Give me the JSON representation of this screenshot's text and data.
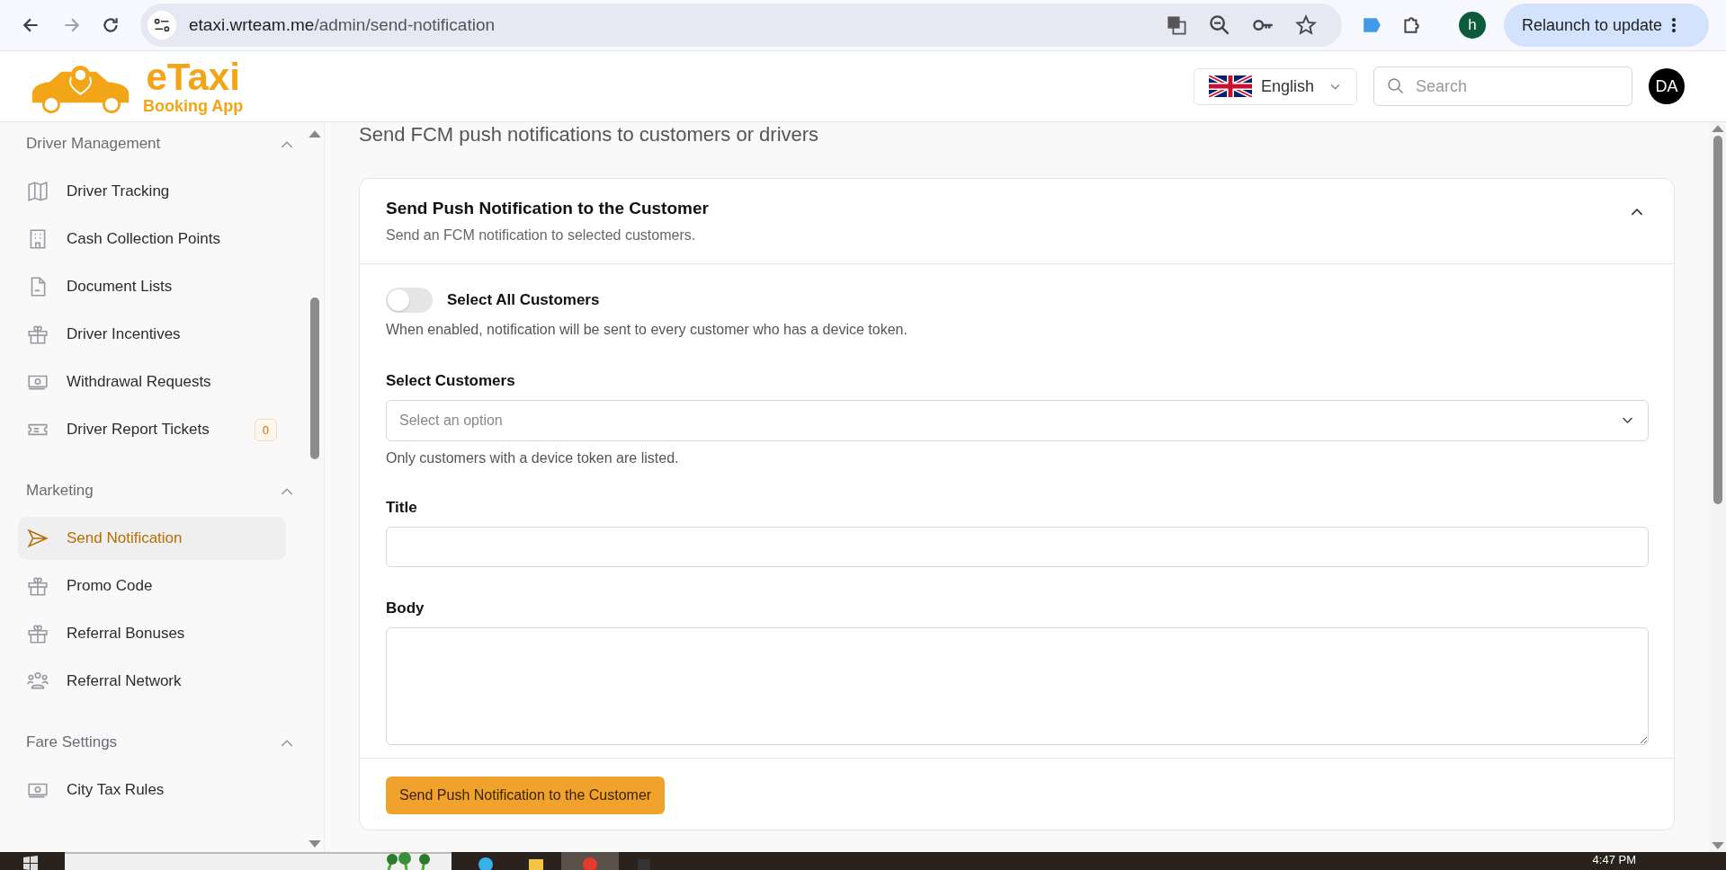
{
  "browser": {
    "url_host": "etaxi.wrteam.me",
    "url_path": "/admin/send-notification",
    "profile": "h",
    "relaunch": "Relaunch to update"
  },
  "header": {
    "logo_title": "eTaxi",
    "logo_subtitle": "Booking App",
    "language": "English",
    "search": {
      "placeholder": "Search"
    },
    "avatar": "DA"
  },
  "sidebar": {
    "sections": [
      {
        "title": "Driver Management",
        "expanded": true,
        "items": [
          {
            "label": "Driver Tracking",
            "selected": false
          },
          {
            "label": "Cash Collection Points",
            "selected": false
          },
          {
            "label": "Document Lists",
            "selected": false
          },
          {
            "label": "Driver Incentives",
            "selected": false
          },
          {
            "label": "Withdrawal Requests",
            "selected": false
          },
          {
            "label": "Driver Report Tickets",
            "selected": false,
            "badge": "0"
          }
        ]
      },
      {
        "title": "Marketing",
        "expanded": true,
        "items": [
          {
            "label": "Send Notification",
            "selected": true
          },
          {
            "label": "Promo Code",
            "selected": false
          },
          {
            "label": "Referral Bonuses",
            "selected": false
          },
          {
            "label": "Referral Network",
            "selected": false
          }
        ]
      },
      {
        "title": "Fare Settings",
        "expanded": true,
        "items": [
          {
            "label": "City Tax Rules",
            "selected": false
          }
        ]
      }
    ]
  },
  "page": {
    "subtitle": "Send FCM push notifications to customers or drivers"
  },
  "card": {
    "title": "Send Push Notification to the Customer",
    "description": "Send an FCM notification to selected customers.",
    "expanded": true,
    "toggle": {
      "label": "Select All Customers",
      "on": false,
      "help": "When enabled, notification will be sent to every customer who has a device token."
    },
    "fields": [
      {
        "kind": "select",
        "label": "Select Customers",
        "placeholder": "Select an option",
        "help": "Only customers with a device token are listed."
      },
      {
        "kind": "text",
        "label": "Title"
      },
      {
        "kind": "textarea",
        "label": "Body"
      }
    ],
    "button": "Send Push Notification to the Customer"
  },
  "taskbar": {
    "time": "4:47 PM"
  }
}
